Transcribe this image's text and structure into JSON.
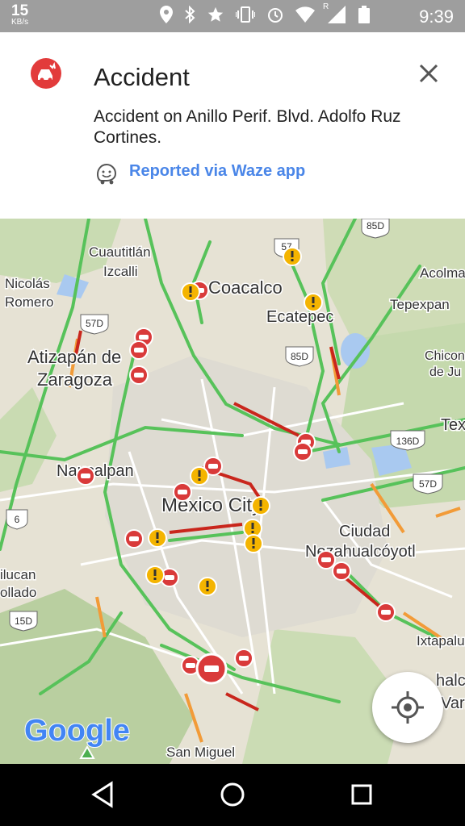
{
  "status_bar": {
    "speed_value": "15",
    "speed_unit": "KB/s",
    "time": "9:39",
    "network_badge": "R"
  },
  "card": {
    "title": "Accident",
    "description": "Accident on Anillo Perif. Blvd. Adolfo Ruz Cortines.",
    "source_link": "Reported via Waze app",
    "accent_color": "#e23b3b",
    "link_color": "#4a86e8"
  },
  "map": {
    "labels": {
      "cuautitlan": "Cuautitlán",
      "izcalli": "Izcalli",
      "nicolas": "Nicolás",
      "romero": "Romero",
      "coacalco": "Coacalco",
      "ecatepec": "Ecatepec",
      "tepexpan": "Tepexpan",
      "acolma": "Acolma",
      "atizapan": "Atizapán de",
      "zaragoza": "Zaragoza",
      "chicon": "Chicon",
      "deju": "de Ju",
      "tex": "Tex",
      "naucalpan": "Naucalpan",
      "mexico_city": "Mexico City",
      "ciudad": "Ciudad",
      "nezahualcoyotl": "Nezahualcóyotl",
      "ilucan": "ilucan",
      "ollado": "ollado",
      "ixtapalu": "Ixtapalu",
      "chalco": "halco",
      "varr": "Varr",
      "san_miguel": "San Miguel"
    },
    "shields": {
      "s85_top": "85D",
      "s57_top": "57",
      "s57_left": "57D",
      "s85_mid": "85D",
      "s136": "136D",
      "s57_right": "57D",
      "s6": "6",
      "s15": "15D"
    },
    "logo_text": "Google"
  },
  "navbar": {
    "icons": [
      "back-icon",
      "home-icon",
      "recents-icon"
    ]
  }
}
